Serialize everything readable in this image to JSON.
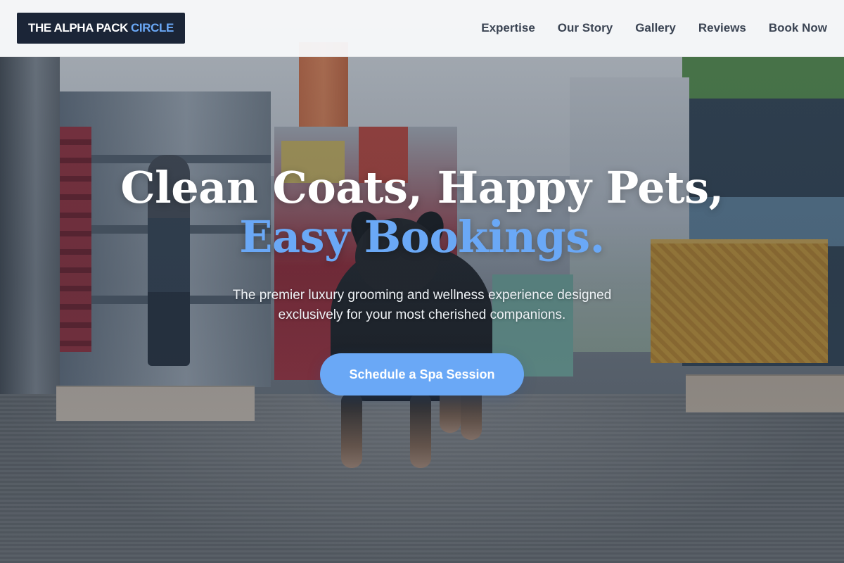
{
  "header": {
    "logo_main": "THE ALPHA PACK",
    "logo_accent": "CIRCLE",
    "nav": [
      "Expertise",
      "Our Story",
      "Gallery",
      "Reviews",
      "Book Now"
    ]
  },
  "hero": {
    "headline_line1": "Clean Coats, Happy Pets,",
    "headline_line2": "Easy Bookings.",
    "subtext": "The premier luxury grooming and wellness experience designed exclusively for your most cherished companions.",
    "cta_label": "Schedule a Spa Session"
  },
  "colors": {
    "brand_dark": "#1b2537",
    "accent": "#6aa8f6",
    "nav_text": "#3b4453"
  }
}
